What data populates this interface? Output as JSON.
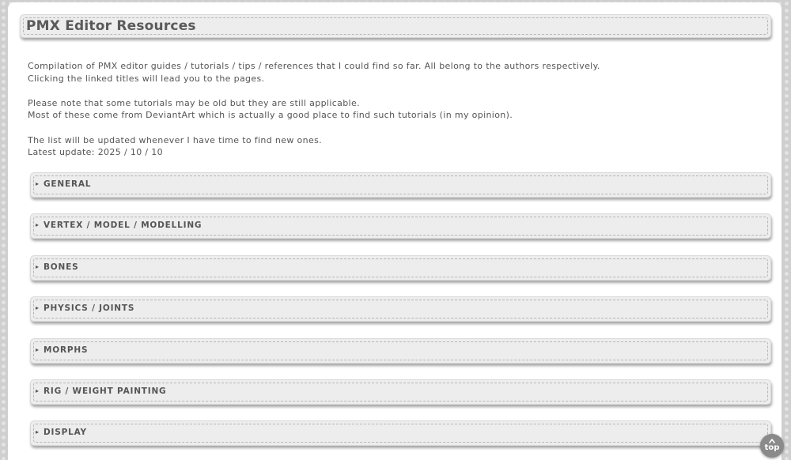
{
  "page": {
    "title": "PMX Editor Resources"
  },
  "intro": {
    "lines": [
      "Compilation of PMX editor guides / tutorials / tips / references that I could find so far. All belong to the authors respectively.",
      "Clicking the linked titles will lead you to the pages.",
      "Please note that some tutorials may be old but they are still applicable.",
      "Most of these come from DeviantArt which is actually a good place to find such tutorials (in my opinion).",
      "The list will be updated whenever I have time to find new ones.",
      "Latest update: 2025 / 10 / 10"
    ]
  },
  "sections": [
    {
      "label": "GENERAL",
      "marker": "▸"
    },
    {
      "label": "VERTEX / MODEL / MODELLING",
      "marker": "▸"
    },
    {
      "label": "BONES",
      "marker": "▸"
    },
    {
      "label": "PHYSICS / JOINTS",
      "marker": "▸"
    },
    {
      "label": "MORPHS",
      "marker": "▸"
    },
    {
      "label": "RIG / WEIGHT PAINTING",
      "marker": "▸"
    },
    {
      "label": "DISPLAY",
      "marker": "▸"
    }
  ],
  "scroll_top": {
    "label": "top",
    "icon": "chevron-up-icon"
  },
  "colors": {
    "background": "#cfcfcf",
    "panel": "#ffffff",
    "box": "#ededed",
    "text": "#555555",
    "top_button": "#8a8a8a"
  }
}
